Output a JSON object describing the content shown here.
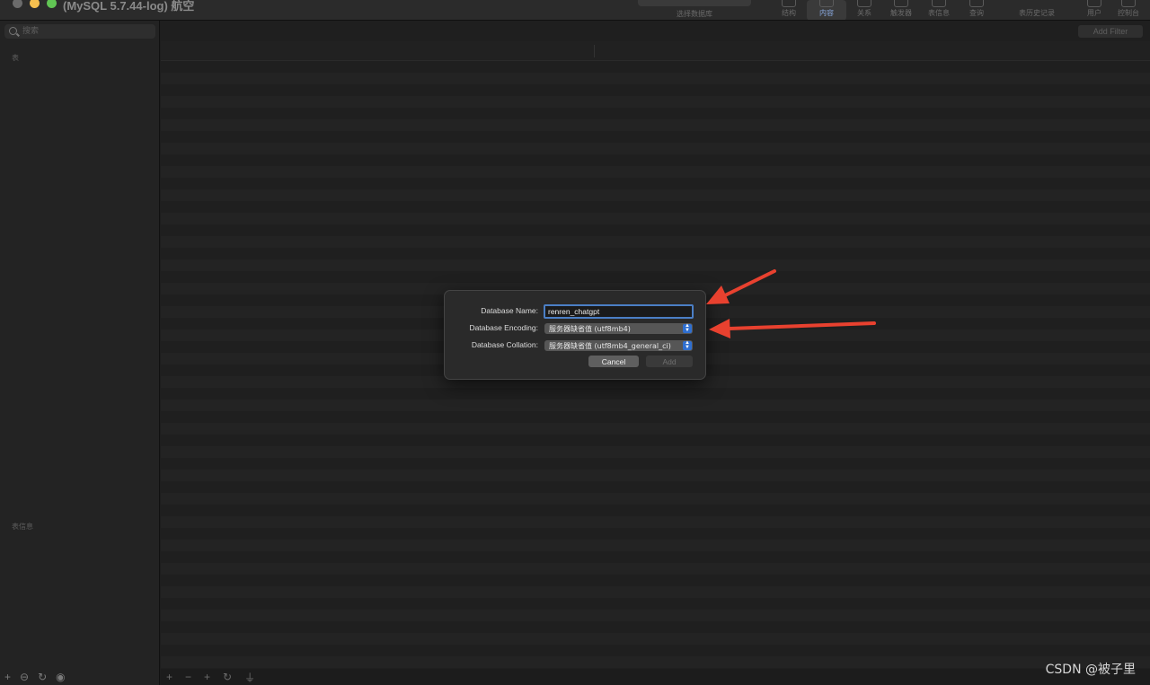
{
  "window": {
    "title": "(MySQL 5.7.44-log) 航空",
    "db_select_label": "选择数据库"
  },
  "toolbar": {
    "items": [
      {
        "label": "结构"
      },
      {
        "label": "内容"
      },
      {
        "label": "关系"
      },
      {
        "label": "触发器"
      },
      {
        "label": "表信息"
      },
      {
        "label": "查询"
      },
      {
        "label": "表历史记录"
      },
      {
        "label": "用户"
      },
      {
        "label": "控制台"
      }
    ]
  },
  "sidebar": {
    "search_placeholder": "搜索",
    "tables_label": "表",
    "table_info_label": "表信息"
  },
  "main": {
    "add_filter_label": "Add Filter"
  },
  "dialog": {
    "name_label": "Database Name:",
    "name_value": "renren_chatgpt",
    "encoding_label": "Database Encoding:",
    "encoding_value": "服务器缺省值 (utf8mb4)",
    "collation_label": "Database Collation:",
    "collation_value": "服务器缺省值 (utf8mb4_general_ci)",
    "cancel_label": "Cancel",
    "add_label": "Add"
  },
  "annotation_color": "#e8412f",
  "watermark": "CSDN @被子里"
}
